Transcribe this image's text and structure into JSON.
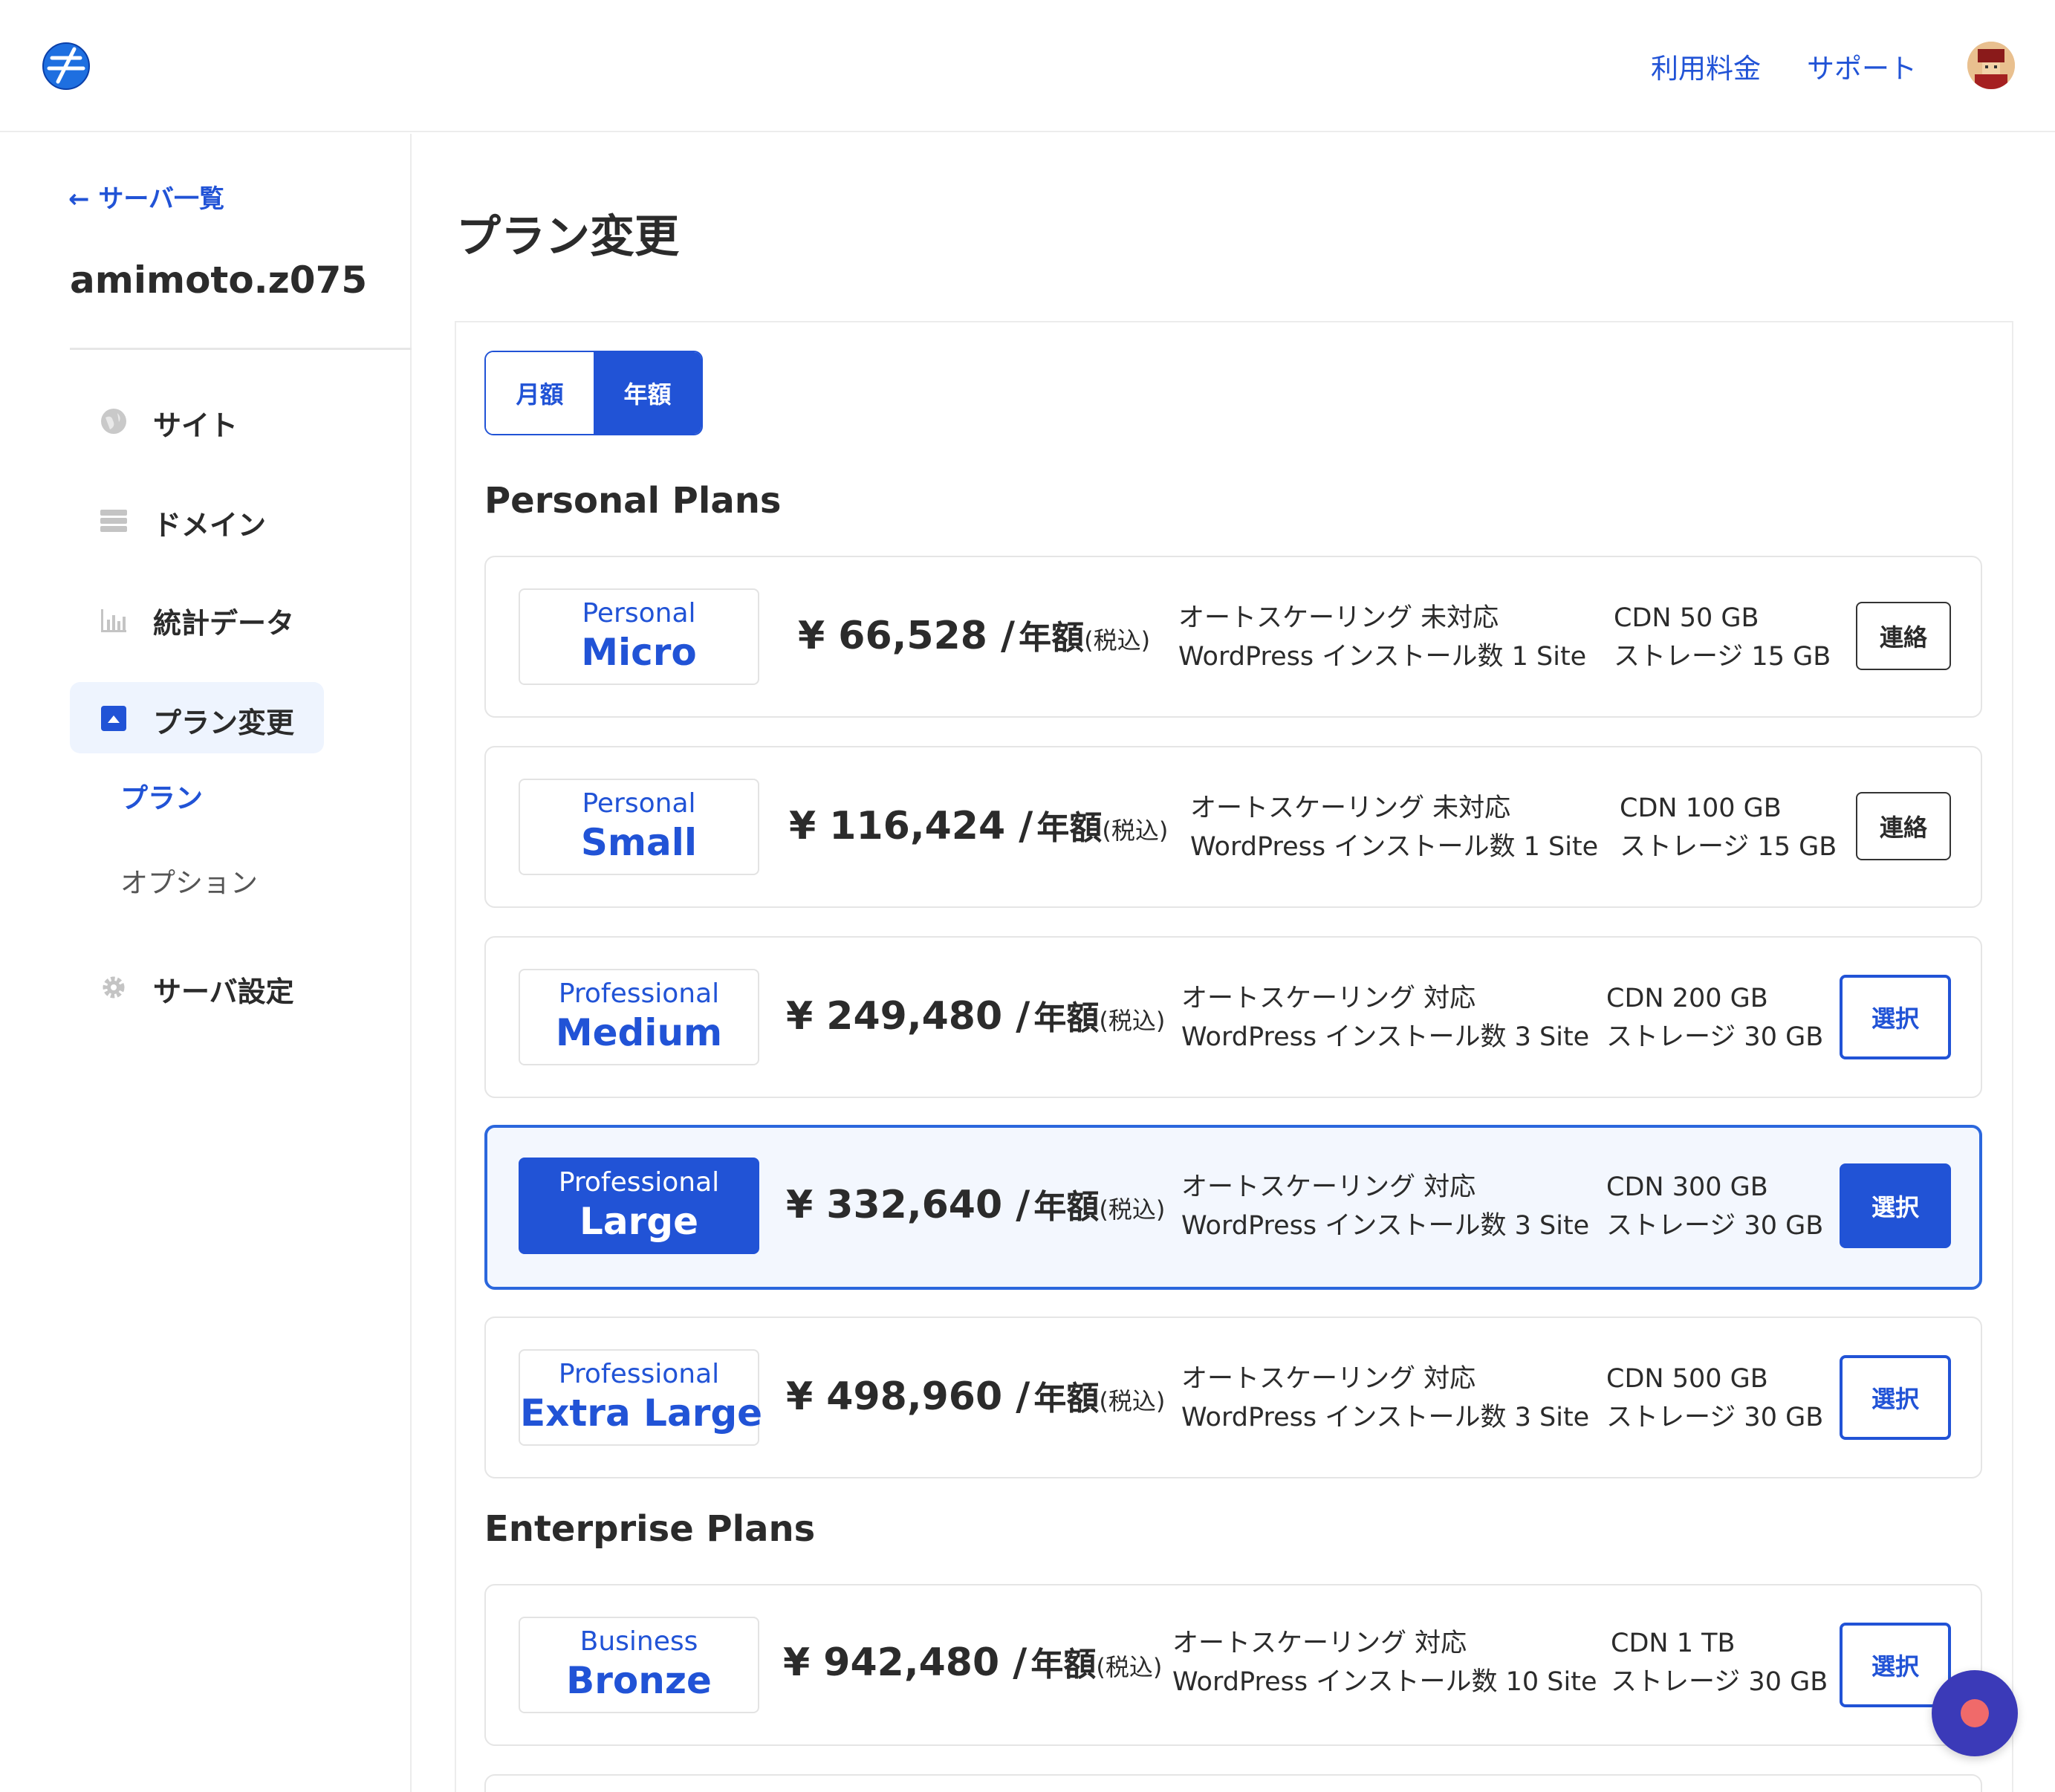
{
  "header": {
    "nav_links": [
      "利用料金",
      "サポート"
    ]
  },
  "sidebar": {
    "back_link": "← サーバ一覧",
    "server_name": "amimoto.z075",
    "items": [
      {
        "label": "サイト",
        "icon": "globe-icon"
      },
      {
        "label": "ドメイン",
        "icon": "server-stack-icon"
      },
      {
        "label": "統計データ",
        "icon": "bar-chart-icon"
      },
      {
        "label": "プラン変更",
        "icon": "plan-icon",
        "active": true
      },
      {
        "label": "サーバ設定",
        "icon": "gear-icon"
      }
    ],
    "sub_items": [
      {
        "label": "プラン",
        "active": true
      },
      {
        "label": "オプション",
        "active": false
      }
    ]
  },
  "main": {
    "title": "プラン変更",
    "billing_toggle": {
      "monthly": "月額",
      "yearly": "年額",
      "selected": "yearly"
    },
    "sections": [
      {
        "title": "Personal Plans",
        "plans": [
          {
            "tier": "Personal",
            "size": "Micro",
            "price": "¥ 66,528 /",
            "period": "年額",
            "tax": "(税込)",
            "autoscaling": "オートスケーリング 未対応",
            "installs": "WordPress インストール数 1 Site",
            "cdn": "CDN 50 GB",
            "storage": "ストレージ 15 GB",
            "button": "連絡",
            "button_type": "contact",
            "selected": false
          },
          {
            "tier": "Personal",
            "size": "Small",
            "price": "¥ 116,424 /",
            "period": "年額",
            "tax": "(税込)",
            "autoscaling": "オートスケーリング 未対応",
            "installs": "WordPress インストール数 1 Site",
            "cdn": "CDN 100 GB",
            "storage": "ストレージ 15 GB",
            "button": "連絡",
            "button_type": "contact",
            "selected": false
          },
          {
            "tier": "Professional",
            "size": "Medium",
            "price": "¥ 249,480 /",
            "period": "年額",
            "tax": "(税込)",
            "autoscaling": "オートスケーリング 対応",
            "installs": "WordPress インストール数 3 Site",
            "cdn": "CDN 200 GB",
            "storage": "ストレージ 30 GB",
            "button": "選択",
            "button_type": "select",
            "selected": false
          },
          {
            "tier": "Professional",
            "size": "Large",
            "price": "¥ 332,640 /",
            "period": "年額",
            "tax": "(税込)",
            "autoscaling": "オートスケーリング 対応",
            "installs": "WordPress インストール数 3 Site",
            "cdn": "CDN 300 GB",
            "storage": "ストレージ 30 GB",
            "button": "選択",
            "button_type": "select",
            "selected": true
          },
          {
            "tier": "Professional",
            "size": "Extra Large",
            "price": "¥ 498,960 /",
            "period": "年額",
            "tax": "(税込)",
            "autoscaling": "オートスケーリング 対応",
            "installs": "WordPress インストール数 3 Site",
            "cdn": "CDN 500 GB",
            "storage": "ストレージ 30 GB",
            "button": "選択",
            "button_type": "select",
            "selected": false
          }
        ]
      },
      {
        "title": "Enterprise Plans",
        "plans": [
          {
            "tier": "Business",
            "size": "Bronze",
            "price": "¥ 942,480 /",
            "period": "年額",
            "tax": "(税込)",
            "autoscaling": "オートスケーリング 対応",
            "installs": "WordPress インストール数 10 Site",
            "cdn": "CDN 1 TB",
            "storage": "ストレージ 30 GB",
            "button": "選択",
            "button_type": "select",
            "selected": false
          }
        ]
      }
    ]
  },
  "colors": {
    "accent": "#2153d6",
    "selected_bg": "#f3f7fe",
    "chat_button": "#3b3ab8",
    "chat_dot": "#f06a6a"
  }
}
